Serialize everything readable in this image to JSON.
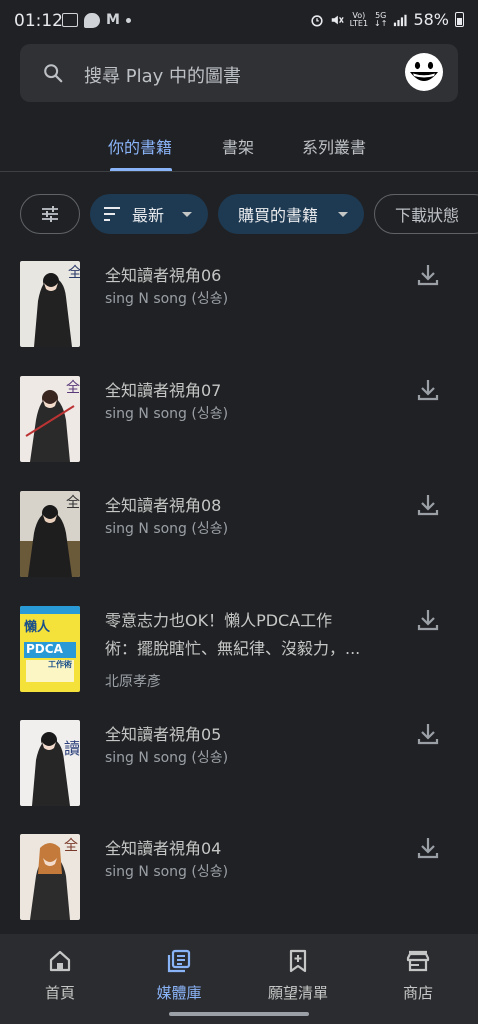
{
  "status_bar": {
    "time": "01:12",
    "battery": "58%",
    "volte_label": "Vo)",
    "lte_label": "LTE1",
    "net_label": "5G"
  },
  "search": {
    "placeholder": "搜尋 Play 中的圖書"
  },
  "tabs": [
    {
      "label": "你的書籍",
      "active": true
    },
    {
      "label": "書架",
      "active": false
    },
    {
      "label": "系列叢書",
      "active": false
    }
  ],
  "filters": {
    "sort_label": "最新",
    "source_label": "購買的書籍",
    "download_label": "下載狀態"
  },
  "books": [
    {
      "title": "全知讀者視角06",
      "author": "sing N song (싱숑)"
    },
    {
      "title": "全知讀者視角07",
      "author": "sing N song (싱숑)"
    },
    {
      "title": "全知讀者視角08",
      "author": "sing N song (싱숑)"
    },
    {
      "title": "零意志力也OK！懶人PDCA工作術：擺脫瞎忙、無紀律、沒毅力，...",
      "title_line1": "零意志力也OK！懶人PDCA工作",
      "title_line2": "術：擺脫瞎忙、無紀律、沒毅力，...",
      "author": "北原孝彥",
      "cover_text_1": "懶人",
      "cover_text_2": "PDCA",
      "cover_text_3": "工作術"
    },
    {
      "title": "全知讀者視角05",
      "author": "sing N song (싱숑)"
    },
    {
      "title": "全知讀者視角04",
      "author": "sing N song (싱숑)"
    }
  ],
  "bottom_nav": [
    {
      "label": "首頁",
      "icon": "home-icon",
      "active": false
    },
    {
      "label": "媒體庫",
      "icon": "library-icon",
      "active": true
    },
    {
      "label": "願望清單",
      "icon": "bookmark-add-icon",
      "active": false
    },
    {
      "label": "商店",
      "icon": "store-icon",
      "active": false
    }
  ],
  "colors": {
    "background": "#202124",
    "accent": "#8ab4f8",
    "chip_filled": "#1e3a52"
  }
}
